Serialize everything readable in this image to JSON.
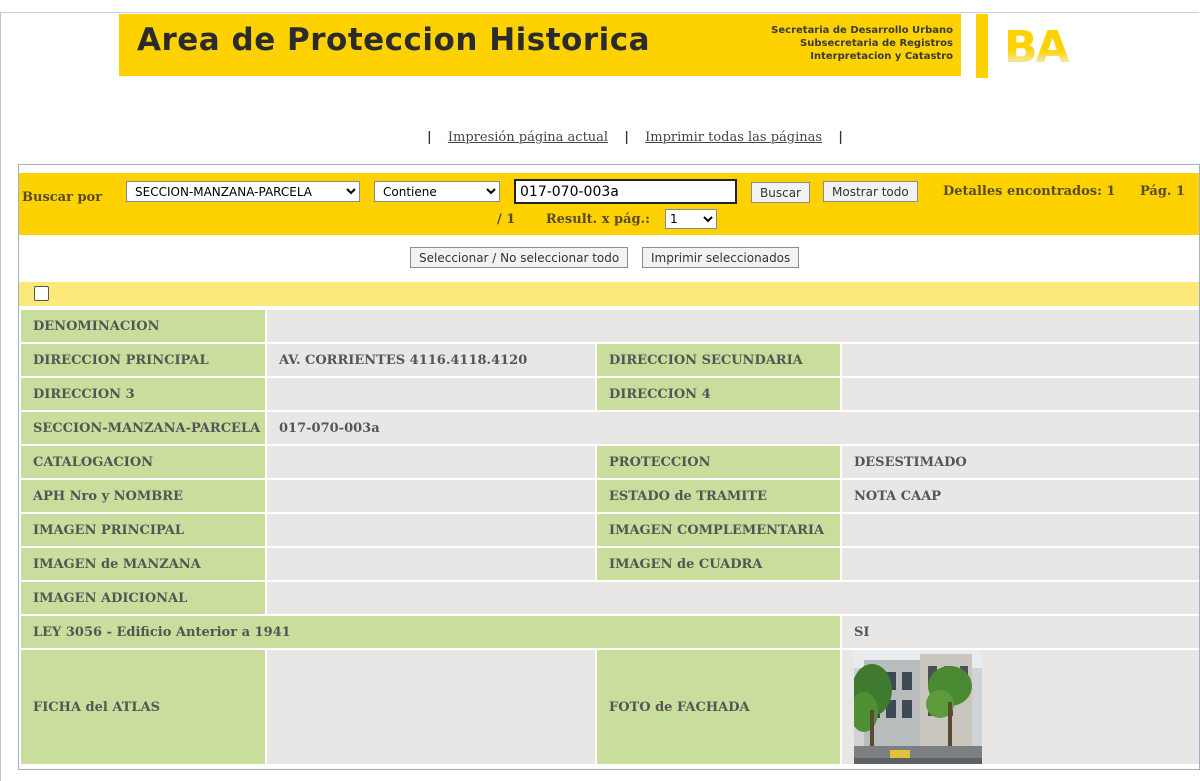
{
  "header": {
    "title": "Area de Proteccion Historica",
    "subtitle_lines": [
      "Secretaria de Desarrollo Urbano",
      "Subsecretaria de Registros",
      "Interpretacion y Catastro"
    ],
    "logo_text": "BA",
    "brand_color": "#fdd200"
  },
  "print_links": {
    "current_page": "Impresión página actual",
    "all_pages": "Imprimir todas las páginas",
    "separator": "|"
  },
  "search": {
    "label": "Buscar por",
    "field_selected": "SECCION-MANZANA-PARCELA",
    "operator_selected": "Contiene",
    "query": "017-070-003a",
    "search_button": "Buscar",
    "show_all_button": "Mostrar todo",
    "details_found": "Detalles encontrados: 1",
    "page_prefix": "Pág. 1",
    "page_total": "/ 1",
    "results_per_page_label": "Result. x pág.:",
    "results_per_page": "1"
  },
  "actions": {
    "select_toggle": "Seleccionar / No seleccionar todo",
    "print_selected": "Imprimir seleccionados"
  },
  "record": {
    "denominacion_label": "DENOMINACION",
    "denominacion": "",
    "direccion_principal_label": "DIRECCION PRINCIPAL",
    "direccion_principal": "AV. CORRIENTES 4116.4118.4120",
    "direccion_secundaria_label": "DIRECCION SECUNDARIA",
    "direccion_secundaria": "",
    "direccion3_label": "DIRECCION 3",
    "direccion3": "",
    "direccion4_label": "DIRECCION 4",
    "direccion4": "",
    "smp_label": "SECCION-MANZANA-PARCELA",
    "smp": "017-070-003a",
    "catalogacion_label": "CATALOGACION",
    "catalogacion": "",
    "proteccion_label": "PROTECCION",
    "proteccion": "DESESTIMADO",
    "aph_label": "APH Nro y NOMBRE",
    "aph": "",
    "estado_label": "ESTADO de TRAMITE",
    "estado": "NOTA CAAP",
    "imagen_principal_label": "IMAGEN PRINCIPAL",
    "imagen_complementaria_label": "IMAGEN COMPLEMENTARIA",
    "imagen_manzana_label": "IMAGEN de MANZANA",
    "imagen_cuadra_label": "IMAGEN de CUADRA",
    "imagen_adicional_label": "IMAGEN ADICIONAL",
    "ley_label": "LEY 3056 - Edificio Anterior a 1941",
    "ley": "SI",
    "ficha_label": "FICHA del ATLAS",
    "foto_label": "FOTO de FACHADA"
  },
  "colors": {
    "label_cell": "#c9dd9c",
    "value_cell": "#e9e7e5",
    "checkbox_bar": "#fde97a"
  }
}
